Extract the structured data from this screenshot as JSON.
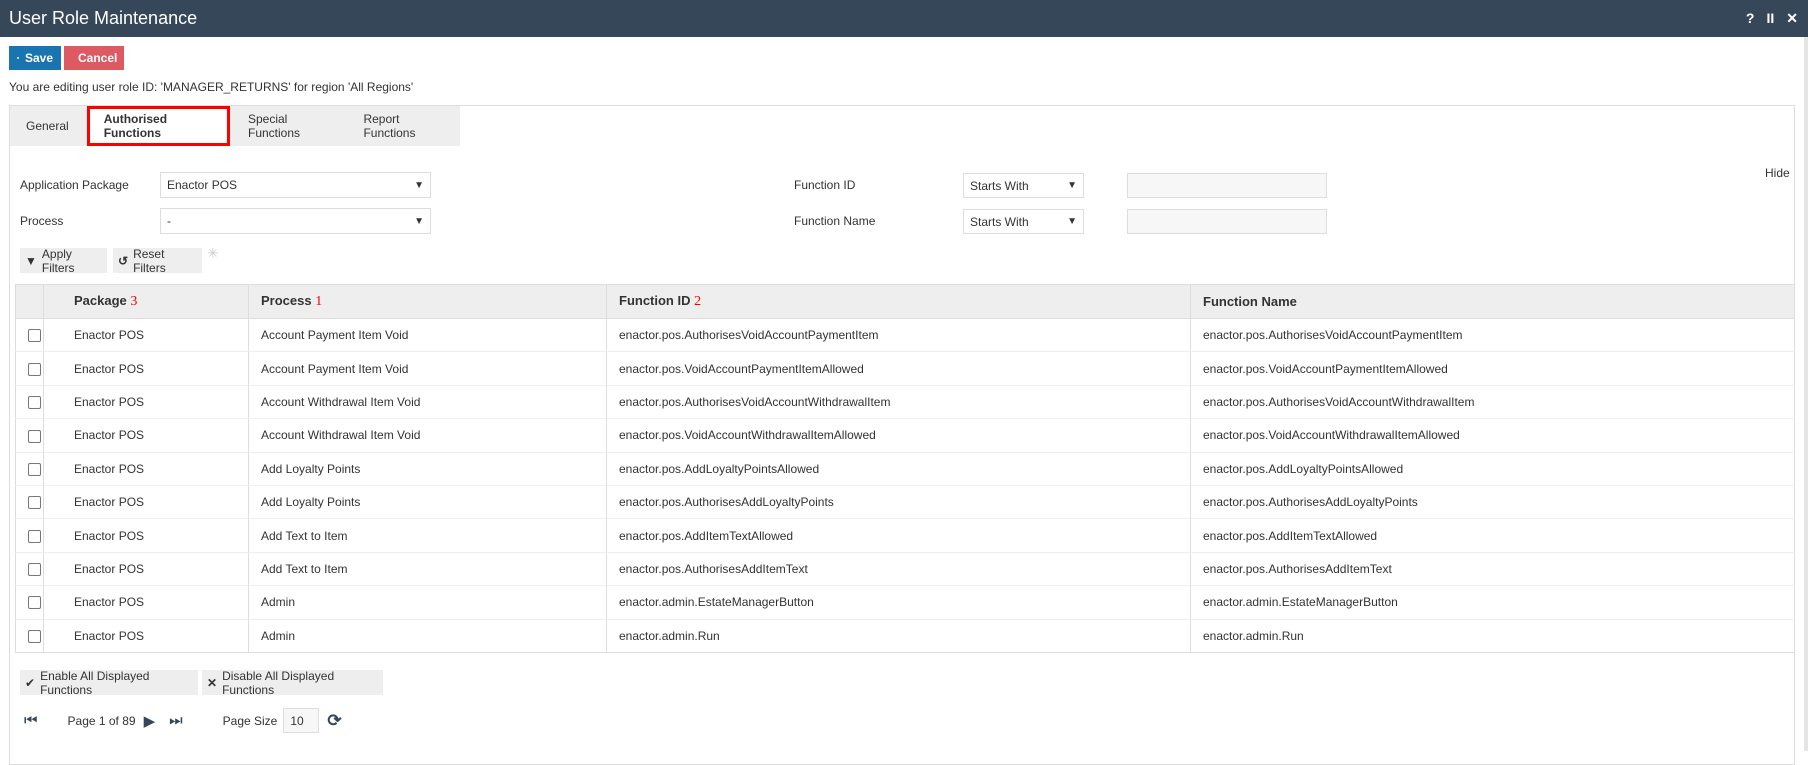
{
  "window": {
    "title": "User Role Maintenance",
    "help": "?",
    "pause": "II",
    "close": "✕"
  },
  "toolbar": {
    "save": "Save",
    "cancel": "Cancel"
  },
  "info": "You are editing user role ID: 'MANAGER_RETURNS' for region 'All Regions'",
  "tabs": [
    "General",
    "Authorised Functions",
    "Special Functions",
    "Report Functions"
  ],
  "filters": {
    "app_package_label": "Application Package",
    "app_package_value": "Enactor POS",
    "process_label": "Process",
    "process_value": "-",
    "function_id_label": "Function ID",
    "function_id_op": "Starts With",
    "function_id_value": "",
    "function_name_label": "Function Name",
    "function_name_op": "Starts With",
    "function_name_value": "",
    "hide": "Hide",
    "apply": "Apply Filters",
    "reset": "Reset Filters"
  },
  "table": {
    "headers": [
      {
        "label": "Package",
        "sort": "3"
      },
      {
        "label": "Process",
        "sort": "1"
      },
      {
        "label": "Function ID",
        "sort": "2"
      },
      {
        "label": "Function Name",
        "sort": ""
      }
    ],
    "rows": [
      [
        "Enactor POS",
        "Account Payment Item Void",
        "enactor.pos.AuthorisesVoidAccountPaymentItem",
        "enactor.pos.AuthorisesVoidAccountPaymentItem"
      ],
      [
        "Enactor POS",
        "Account Payment Item Void",
        "enactor.pos.VoidAccountPaymentItemAllowed",
        "enactor.pos.VoidAccountPaymentItemAllowed"
      ],
      [
        "Enactor POS",
        "Account Withdrawal Item Void",
        "enactor.pos.AuthorisesVoidAccountWithdrawalItem",
        "enactor.pos.AuthorisesVoidAccountWithdrawalItem"
      ],
      [
        "Enactor POS",
        "Account Withdrawal Item Void",
        "enactor.pos.VoidAccountWithdrawalItemAllowed",
        "enactor.pos.VoidAccountWithdrawalItemAllowed"
      ],
      [
        "Enactor POS",
        "Add Loyalty Points",
        "enactor.pos.AddLoyaltyPointsAllowed",
        "enactor.pos.AddLoyaltyPointsAllowed"
      ],
      [
        "Enactor POS",
        "Add Loyalty Points",
        "enactor.pos.AuthorisesAddLoyaltyPoints",
        "enactor.pos.AuthorisesAddLoyaltyPoints"
      ],
      [
        "Enactor POS",
        "Add Text to Item",
        "enactor.pos.AddItemTextAllowed",
        "enactor.pos.AddItemTextAllowed"
      ],
      [
        "Enactor POS",
        "Add Text to Item",
        "enactor.pos.AuthorisesAddItemText",
        "enactor.pos.AuthorisesAddItemText"
      ],
      [
        "Enactor POS",
        "Admin",
        "enactor.admin.EstateManagerButton",
        "enactor.admin.EstateManagerButton"
      ],
      [
        "Enactor POS",
        "Admin",
        "enactor.admin.Run",
        "enactor.admin.Run"
      ]
    ]
  },
  "bulk": {
    "enable": "Enable All Displayed Functions",
    "disable": "Disable All Displayed Functions"
  },
  "pager": {
    "text": "Page 1 of 89",
    "page_size_label": "Page Size",
    "page_size": "10"
  }
}
